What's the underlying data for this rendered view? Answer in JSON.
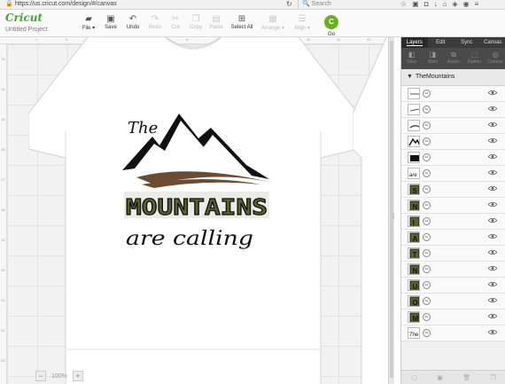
{
  "browser": {
    "url": "https://us.cricut.com/design/#/canvas",
    "search_placeholder": "Search"
  },
  "app": {
    "logo": "Cricut",
    "project_name": "Untitled Project"
  },
  "toolbar": {
    "file": "File ▾",
    "save": "Save",
    "undo": "Undo",
    "redo": "Redo",
    "cut": "Cut",
    "copy": "Copy",
    "paste": "Paste",
    "select_all": "Select All",
    "arrange": "Arrange ▾",
    "align": "Align ▾",
    "go": "Go",
    "go_icon_text": "C"
  },
  "canvas": {
    "design": {
      "title_word": "The",
      "main_word": "MOUNTAINS",
      "sub_phrase": "are calling"
    },
    "zoom_level": "100%",
    "zoom_minus": "−",
    "zoom_plus": "+",
    "ruler_left": [
      "13",
      "14",
      "15",
      "16",
      "17",
      "18",
      "19",
      "20",
      "21",
      "22",
      "23",
      "24"
    ],
    "ruler_top": [
      "1",
      "2",
      "3",
      "4",
      "5",
      "6",
      "7",
      "8",
      "9",
      "10",
      "11",
      "12",
      "13"
    ]
  },
  "panel": {
    "tabs": [
      "Layers",
      "Edit",
      "Sync",
      "Canvas"
    ],
    "active_tab": "Layers",
    "actions": [
      "Slice",
      "Weld",
      "Attach",
      "Flatten",
      "Contour"
    ],
    "group_name": "TheMountains",
    "layers": [
      {
        "thumb": "line-1"
      },
      {
        "thumb": "line-2"
      },
      {
        "thumb": "swoosh"
      },
      {
        "thumb": "peaks"
      },
      {
        "thumb": "block"
      },
      {
        "thumb": "are"
      },
      {
        "thumb": "S"
      },
      {
        "thumb": "N"
      },
      {
        "thumb": "I"
      },
      {
        "thumb": "A"
      },
      {
        "thumb": "T"
      },
      {
        "thumb": "N"
      },
      {
        "thumb": "U"
      },
      {
        "thumb": "O"
      },
      {
        "thumb": "M"
      },
      {
        "thumb": "The"
      }
    ]
  },
  "colors": {
    "brand_green": "#6ab023",
    "letter_olive": "#5d6130",
    "swoosh_brown": "#6b4c32",
    "panel_dark": "#3b3b3b"
  }
}
